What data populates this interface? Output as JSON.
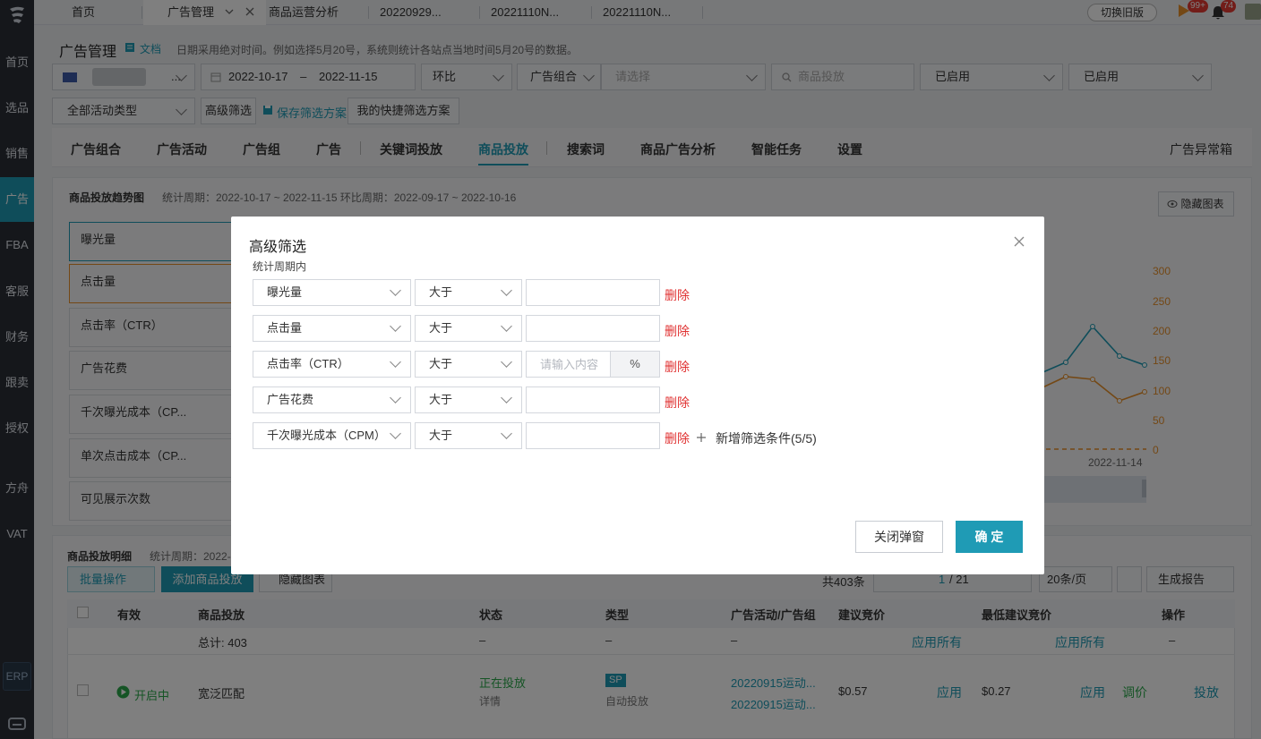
{
  "sidebar": {
    "items": [
      "首页",
      "选品",
      "销售",
      "广告",
      "FBA",
      "客服",
      "财务",
      "跟卖",
      "授权",
      "方舟",
      "VAT"
    ],
    "active": "广告",
    "erp": "ERP"
  },
  "topbar": {
    "tabs": [
      "首页",
      "广告管理",
      "商品运营分析",
      "20220929...",
      "20221110N...",
      "20221110N..."
    ],
    "switch_old": "切换旧版",
    "badge_flag": "99+",
    "badge_bell": "74"
  },
  "header": {
    "title": "广告管理",
    "docs": "文档",
    "tip": "日期采用绝对时间。例如选择5月20号，系统则统计各站点当地时间5月20号的数据。"
  },
  "filters": {
    "store": "...",
    "date_start": "2022-10-17",
    "date_sep": "–",
    "date_end": "2022-11-15",
    "compare": "环比",
    "group_label": "广告组合",
    "group_placeholder": "请选择",
    "search_placeholder": "商品投放",
    "status1": "已启用",
    "status2": "已启用",
    "activity_type": "全部活动类型",
    "advanced": "高级筛选",
    "save_scheme": "保存筛选方案",
    "my_schemes": "我的快捷筛选方案"
  },
  "nav_tabs": [
    "广告组合",
    "广告活动",
    "广告组",
    "广告",
    "关键词投放",
    "商品投放",
    "搜索词",
    "商品广告分析",
    "智能任务",
    "设置"
  ],
  "nav_active": "商品投放",
  "nav_right": "广告异常箱",
  "trend": {
    "title": "商品投放趋势图",
    "period": "统计周期：2022-10-17 ~ 2022-11-15 环比周期：2022-09-17 ~ 2022-10-16",
    "hide_chart": "隐藏图表",
    "metrics": [
      "曝光量",
      "点击量",
      "点击率（CTR）",
      "广告花费",
      "千次曝光成本（CP...",
      "单次点击成本（CP...",
      "可见展示次数"
    ],
    "y_ticks": [
      "300",
      "250",
      "200",
      "150",
      "100",
      "50",
      "0"
    ],
    "x_label": "2022-11-14"
  },
  "detail": {
    "title": "商品投放明细",
    "period": "统计周期：2022-",
    "batch": "批量操作",
    "add": "添加商品投放",
    "hide_chart": "隐藏图表",
    "total_count": "共403条",
    "page_current": "1",
    "page_total": "/ 21",
    "page_size": "20条/页",
    "report": "生成报告",
    "columns": [
      "有效",
      "商品投放",
      "状态",
      "类型",
      "广告活动/广告组",
      "建议竞价",
      "最低建议竞价",
      "操作"
    ],
    "summary": {
      "label": "总计: 403",
      "status": "–",
      "type": "–",
      "campaign": "–",
      "bid": "应用所有",
      "min_bid": "应用所有",
      "op": "–"
    },
    "row": {
      "enabled": "开启中",
      "target": "宽泛匹配",
      "status": "正在投放",
      "status_detail": "详情",
      "type_badge": "SP",
      "type_text": "自动投放",
      "campaign1": "20220915运动...",
      "campaign2": "20220915运动...",
      "bid": "$0.57",
      "bid_apply": "应用",
      "min_bid": "$0.27",
      "min_bid_apply": "应用",
      "adjust": "调价",
      "deliver": "投放"
    }
  },
  "modal": {
    "title": "高级筛选",
    "subtitle": "统计周期内",
    "rows": [
      {
        "metric": "曝光量",
        "op": "大于",
        "value": "",
        "placeholder": "",
        "unit": ""
      },
      {
        "metric": "点击量",
        "op": "大于",
        "value": "",
        "placeholder": "",
        "unit": ""
      },
      {
        "metric": "点击率（CTR）",
        "op": "大于",
        "value": "",
        "placeholder": "请输入内容",
        "unit": "%"
      },
      {
        "metric": "广告花费",
        "op": "大于",
        "value": "",
        "placeholder": "",
        "unit": ""
      },
      {
        "metric": "千次曝光成本（CPM）",
        "op": "大于",
        "value": "",
        "placeholder": "",
        "unit": ""
      }
    ],
    "delete_label": "删除",
    "add_condition": "新增筛选条件(5/5)",
    "close_button": "关闭弹窗",
    "confirm_button": "确 定"
  },
  "colors": {
    "accent": "#1f9bb5",
    "danger": "#e03131",
    "orange": "#e8902a",
    "sidebar_bg": "#2b2f36"
  }
}
